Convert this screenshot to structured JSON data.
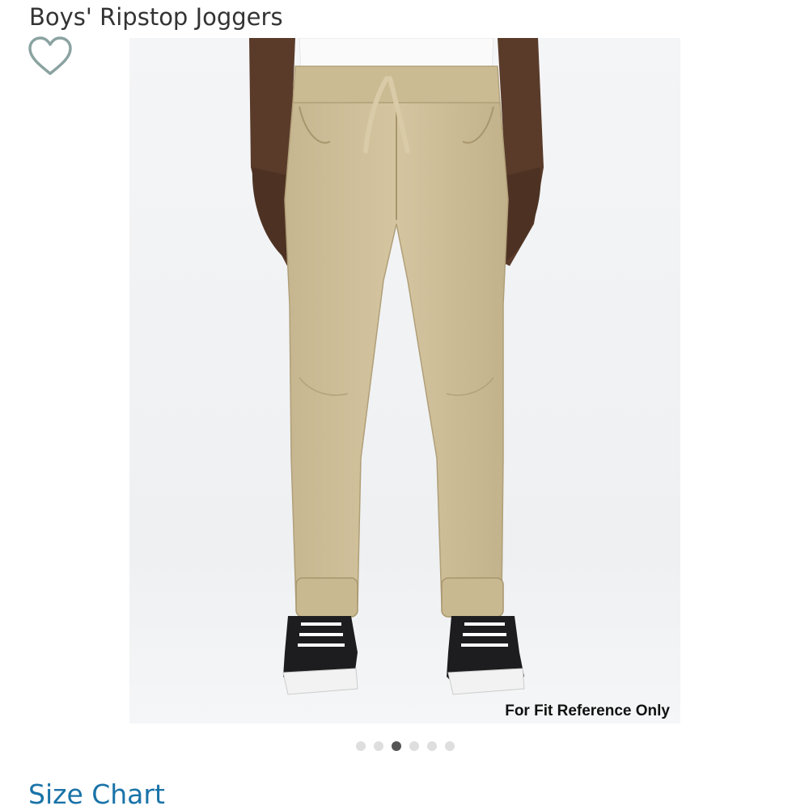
{
  "product": {
    "title": "Boys' Ripstop Joggers"
  },
  "wishlist": {
    "icon": "heart-outline-icon",
    "color": "#8aa3a1"
  },
  "image": {
    "caption": "For Fit Reference Only"
  },
  "carousel": {
    "total": 6,
    "active_index": 2
  },
  "links": {
    "size_chart": "Size Chart",
    "color": "#1a73a8"
  }
}
